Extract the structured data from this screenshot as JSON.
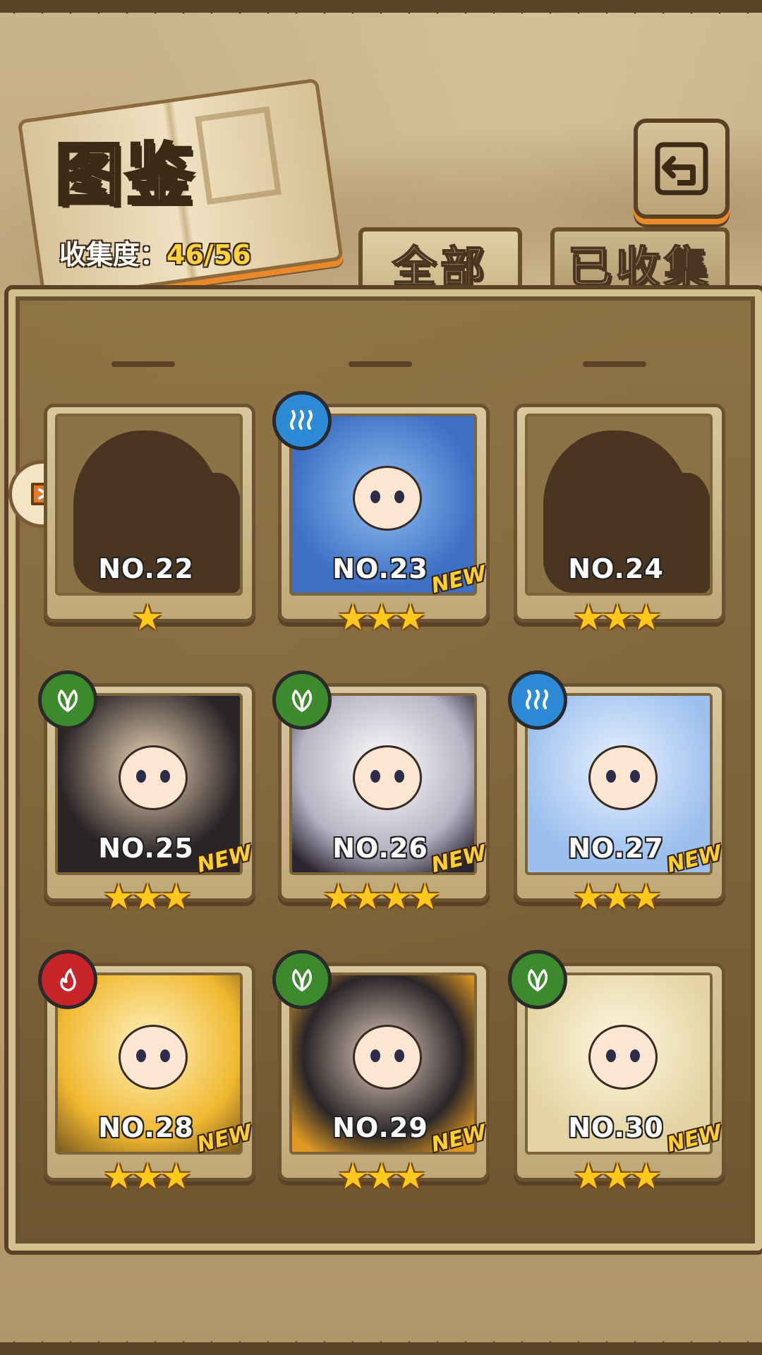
{
  "header": {
    "title": "图鉴",
    "collect_label": "收集度：",
    "collect_value": "46/56"
  },
  "tabs": [
    {
      "label": "全部",
      "active": true
    },
    {
      "label": "已收集",
      "active": false
    }
  ],
  "cards": [
    {
      "no": "NO.22",
      "stars": "★",
      "new": "",
      "element": "",
      "style": "silhouette"
    },
    {
      "no": "NO.23",
      "stars": "★★★",
      "new": "NEW",
      "element": "water",
      "style": "blue"
    },
    {
      "no": "NO.24",
      "stars": "★★★",
      "new": "",
      "element": "",
      "style": "silhouette"
    },
    {
      "no": "NO.25",
      "stars": "★★★",
      "new": "NEW",
      "element": "wood",
      "style": "black"
    },
    {
      "no": "NO.26",
      "stars": "★★★★",
      "new": "NEW",
      "element": "wood",
      "style": "white"
    },
    {
      "no": "NO.27",
      "stars": "★★★",
      "new": "NEW",
      "element": "water",
      "style": "ice"
    },
    {
      "no": "NO.28",
      "stars": "★★★",
      "new": "NEW",
      "element": "fire",
      "style": "gold"
    },
    {
      "no": "NO.29",
      "stars": "★★★",
      "new": "NEW",
      "element": "wood",
      "style": "witch"
    },
    {
      "no": "NO.30",
      "stars": "★★★",
      "new": "NEW",
      "element": "wood",
      "style": "fairy"
    }
  ],
  "colors": {
    "accent": "#ffd23a",
    "frame": "#d3c08f",
    "water": "#2c8ad6",
    "wood": "#3d8a2e",
    "fire": "#c8242a"
  },
  "icons": {
    "back": "return-arrow-icon",
    "side": "bookmark-arrow-icon",
    "water": "water-element-icon",
    "wood": "leaf-element-icon",
    "fire": "flame-element-icon"
  }
}
